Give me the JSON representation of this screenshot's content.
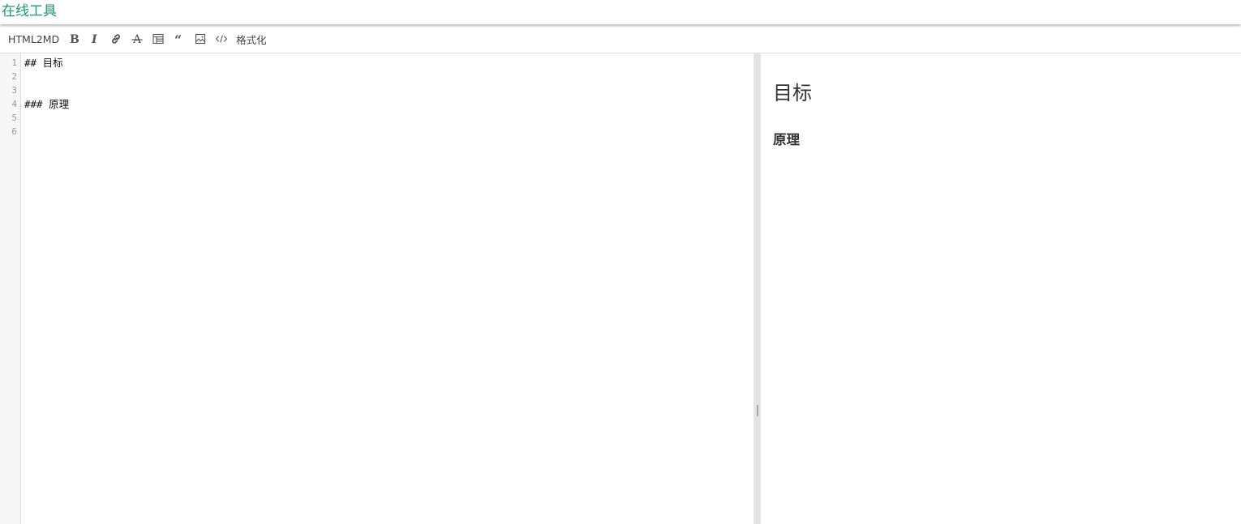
{
  "header": {
    "brand": "在线工具"
  },
  "toolbar": {
    "html2md": "HTML2MD",
    "format": "格式化",
    "icons": [
      "bold-icon",
      "italic-icon",
      "link-icon",
      "strikethrough-icon",
      "table-icon",
      "quote-icon",
      "image-icon",
      "code-icon"
    ]
  },
  "editor": {
    "line_numbers": [
      "1",
      "2",
      "3",
      "4",
      "5",
      "6"
    ],
    "lines": [
      "## 目标",
      "",
      "",
      "### 原理",
      "",
      ""
    ]
  },
  "preview": {
    "h2": "目标",
    "h3": "原理"
  },
  "colors": {
    "brand": "#1a9a6c",
    "text": "#333333"
  }
}
